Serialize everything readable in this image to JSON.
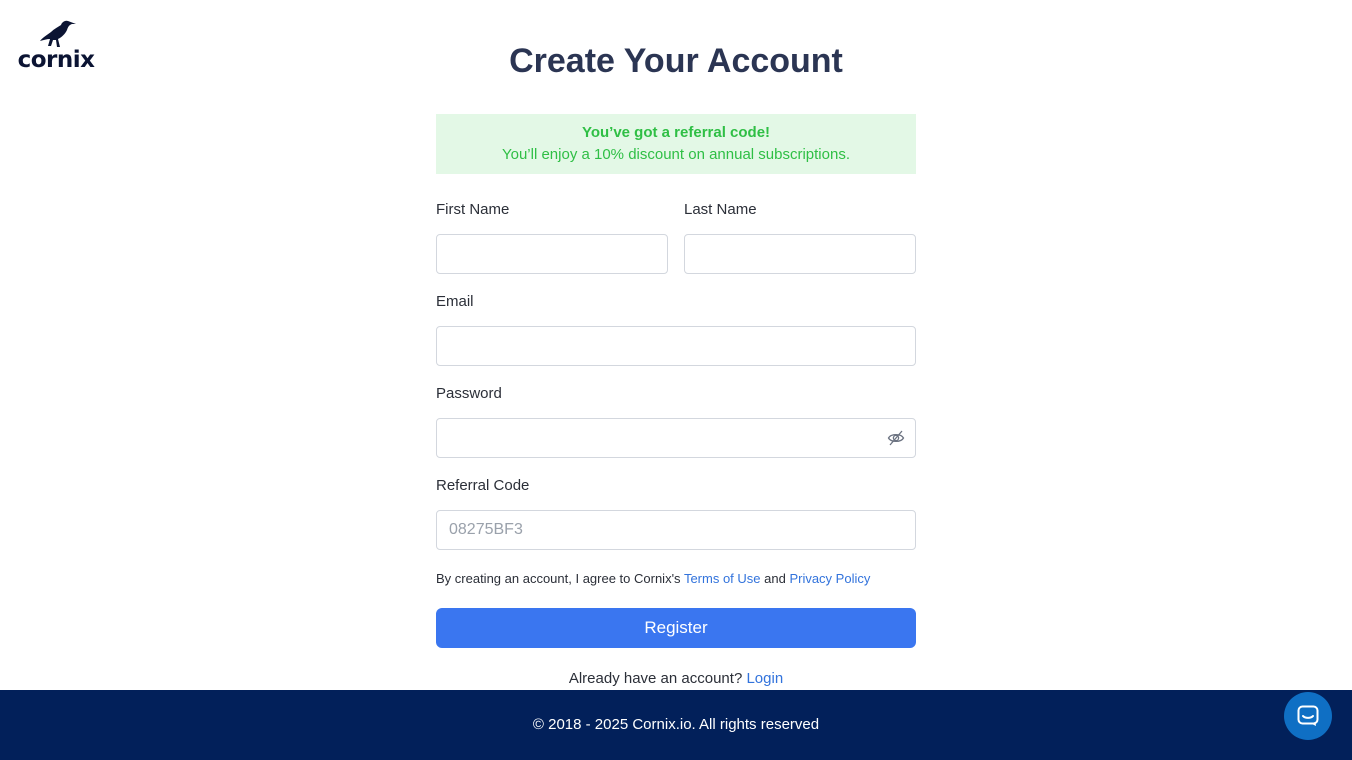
{
  "brand": {
    "name": "cornix",
    "logo_icon": "raven-icon",
    "color": "#0b1433"
  },
  "page": {
    "title": "Create Your Account"
  },
  "referral_banner": {
    "title": "You’ve got a referral code!",
    "text": "You’ll enjoy a 10% discount on annual subscriptions.",
    "color": "#2fbf45",
    "background": "#e3f8e6"
  },
  "form": {
    "first_name": {
      "label": "First Name",
      "value": "",
      "placeholder": ""
    },
    "last_name": {
      "label": "Last Name",
      "value": "",
      "placeholder": ""
    },
    "email": {
      "label": "Email",
      "value": "",
      "placeholder": ""
    },
    "password": {
      "label": "Password",
      "value": "",
      "placeholder": "",
      "toggle_icon": "eye-off-icon"
    },
    "referral_code": {
      "label": "Referral Code",
      "value": "",
      "placeholder": "08275BF3"
    },
    "terms": {
      "prefix": "By creating an account, I agree to Cornix's ",
      "terms_link": "Terms of Use",
      "joiner": " and ",
      "privacy_link": "Privacy Policy"
    },
    "submit_label": "Register",
    "login_prompt": "Already have an account? ",
    "login_link": "Login"
  },
  "footer": {
    "text": "© 2018 - 2025 Cornix.io. All rights reserved",
    "background": "#02205a"
  },
  "chat_widget": {
    "icon": "chat-icon",
    "color": "#0f6fc4"
  },
  "colors": {
    "accent": "#3a76f0",
    "link": "#3273dc",
    "title": "#2b3553"
  }
}
